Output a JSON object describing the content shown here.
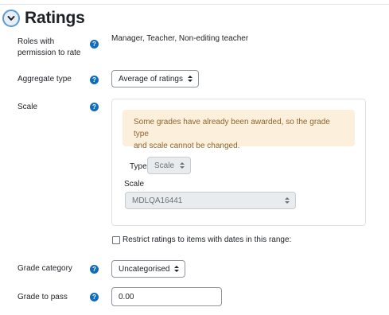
{
  "section": {
    "title": "Ratings",
    "toggle_icon": "chevron-down-icon"
  },
  "help_icon": "question-circle-icon",
  "fields": {
    "roles": {
      "label_line1": "Roles with",
      "label_line2": "permission to rate",
      "value": "Manager, Teacher, Non-editing teacher"
    },
    "aggregate": {
      "label": "Aggregate type",
      "value": "Average of ratings"
    },
    "scale": {
      "label": "Scale",
      "warning_line1": "Some grades have already been awarded, so the grade type",
      "warning_line2": "and scale cannot be changed.",
      "type_label": "Type",
      "type_value": "Scale",
      "scale_label": "Scale",
      "scale_value": "MDLQA16441"
    },
    "restrict": {
      "label": "Restrict ratings to items with dates in this range:",
      "checked": false
    },
    "grade_category": {
      "label": "Grade category",
      "value": "Uncategorised"
    },
    "grade_to_pass": {
      "label": "Grade to pass",
      "value": "0.00"
    }
  },
  "colors": {
    "help": "#0f6cbf",
    "toggle_border": "#5b9bd5",
    "warning_bg": "#fcefdc",
    "warning_text": "#8e662e"
  }
}
